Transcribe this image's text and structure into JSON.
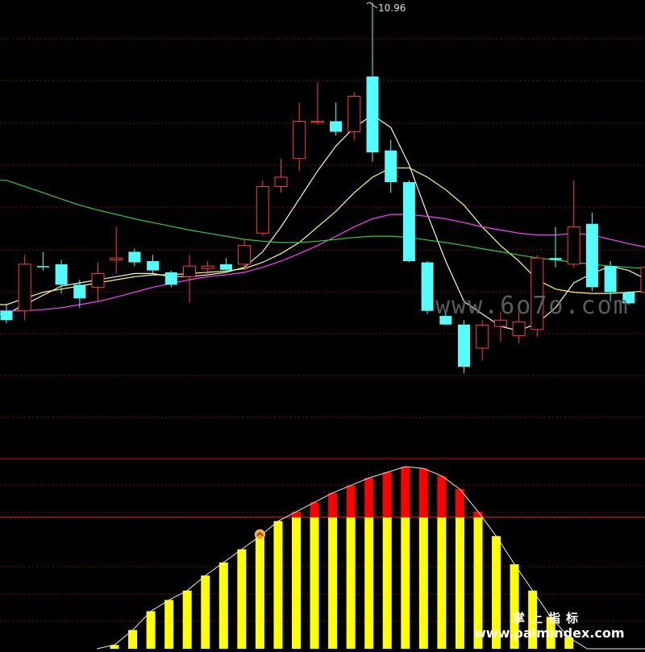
{
  "chart_data": {
    "type": "candlestick",
    "peak_label": "10.96",
    "price_ylim": [
      4.0,
      11.0
    ],
    "candles": [
      {
        "o": 6.0,
        "h": 6.1,
        "l": 5.8,
        "c": 5.85
      },
      {
        "o": 6.0,
        "h": 6.9,
        "l": 5.85,
        "c": 6.75
      },
      {
        "o": 6.72,
        "h": 6.95,
        "l": 6.65,
        "c": 6.7
      },
      {
        "o": 6.75,
        "h": 6.82,
        "l": 6.28,
        "c": 6.42
      },
      {
        "o": 6.42,
        "h": 6.5,
        "l": 6.05,
        "c": 6.2
      },
      {
        "o": 6.38,
        "h": 6.78,
        "l": 6.15,
        "c": 6.6
      },
      {
        "o": 6.82,
        "h": 7.35,
        "l": 6.6,
        "c": 6.85
      },
      {
        "o": 6.95,
        "h": 7.0,
        "l": 6.72,
        "c": 6.78
      },
      {
        "o": 6.8,
        "h": 6.9,
        "l": 6.58,
        "c": 6.65
      },
      {
        "o": 6.62,
        "h": 6.65,
        "l": 6.38,
        "c": 6.42
      },
      {
        "o": 6.55,
        "h": 6.9,
        "l": 6.13,
        "c": 6.72
      },
      {
        "o": 6.68,
        "h": 6.8,
        "l": 6.55,
        "c": 6.72
      },
      {
        "o": 6.75,
        "h": 6.85,
        "l": 6.65,
        "c": 6.66
      },
      {
        "o": 6.75,
        "h": 7.15,
        "l": 6.65,
        "c": 7.05
      },
      {
        "o": 7.25,
        "h": 8.1,
        "l": 7.2,
        "c": 8.0
      },
      {
        "o": 8.0,
        "h": 8.45,
        "l": 7.9,
        "c": 8.15
      },
      {
        "o": 8.45,
        "h": 9.35,
        "l": 8.25,
        "c": 9.05
      },
      {
        "o": 9.05,
        "h": 9.68,
        "l": 9.0,
        "c": 9.05
      },
      {
        "o": 9.05,
        "h": 9.35,
        "l": 8.82,
        "c": 8.88
      },
      {
        "o": 8.88,
        "h": 9.52,
        "l": 8.75,
        "c": 9.45
      },
      {
        "o": 9.77,
        "h": 10.96,
        "l": 8.4,
        "c": 8.55
      },
      {
        "o": 8.58,
        "h": 8.75,
        "l": 7.9,
        "c": 8.07
      },
      {
        "o": 8.07,
        "h": 8.1,
        "l": 6.78,
        "c": 6.8
      },
      {
        "o": 6.78,
        "h": 6.8,
        "l": 5.95,
        "c": 6.0
      },
      {
        "o": 5.92,
        "h": 5.97,
        "l": 5.77,
        "c": 5.78
      },
      {
        "o": 5.78,
        "h": 5.85,
        "l": 5.0,
        "c": 5.1
      },
      {
        "o": 5.4,
        "h": 5.85,
        "l": 5.2,
        "c": 5.77
      },
      {
        "o": 5.75,
        "h": 5.98,
        "l": 5.5,
        "c": 5.85
      },
      {
        "o": 5.6,
        "h": 5.98,
        "l": 5.48,
        "c": 5.82
      },
      {
        "o": 5.7,
        "h": 6.9,
        "l": 5.58,
        "c": 6.85
      },
      {
        "o": 6.85,
        "h": 7.35,
        "l": 6.7,
        "c": 6.82
      },
      {
        "o": 6.75,
        "h": 8.1,
        "l": 6.7,
        "c": 7.35
      },
      {
        "o": 7.4,
        "h": 7.58,
        "l": 6.32,
        "c": 6.38
      },
      {
        "o": 6.72,
        "h": 6.8,
        "l": 6.15,
        "c": 6.3
      },
      {
        "o": 6.3,
        "h": 6.32,
        "l": 6.1,
        "c": 6.12
      },
      {
        "o": 6.3,
        "h": 6.82,
        "l": 6.28,
        "c": 6.7
      }
    ],
    "ma_series": [
      {
        "color": "#f5f5dc",
        "values": [
          5.95,
          6.1,
          6.25,
          6.4,
          6.45,
          6.5,
          6.55,
          6.6,
          6.6,
          6.55,
          6.55,
          6.58,
          6.62,
          6.7,
          6.95,
          7.35,
          7.8,
          8.25,
          8.65,
          8.95,
          9.15,
          8.95,
          8.35,
          7.55,
          6.8,
          6.15,
          5.95,
          5.75,
          5.68,
          5.8,
          6.05,
          6.45,
          6.6,
          6.72,
          6.65,
          6.5
        ]
      },
      {
        "color": "#ffff66",
        "values": [
          6.1,
          6.2,
          6.3,
          6.35,
          6.4,
          6.45,
          6.5,
          6.55,
          6.58,
          6.58,
          6.6,
          6.62,
          6.64,
          6.68,
          6.78,
          6.92,
          7.1,
          7.35,
          7.6,
          7.9,
          8.15,
          8.3,
          8.3,
          8.15,
          7.95,
          7.7,
          7.35,
          7.05,
          6.8,
          6.5,
          6.35,
          6.3,
          6.28,
          6.28,
          6.3,
          6.32
        ]
      },
      {
        "color": "#ff3fff",
        "values": [
          6.0,
          6.0,
          6.02,
          6.05,
          6.1,
          6.15,
          6.22,
          6.3,
          6.38,
          6.44,
          6.5,
          6.55,
          6.58,
          6.62,
          6.7,
          6.8,
          6.92,
          7.05,
          7.2,
          7.35,
          7.48,
          7.55,
          7.55,
          7.52,
          7.48,
          7.42,
          7.35,
          7.3,
          7.25,
          7.22,
          7.22,
          7.25,
          7.22,
          7.15,
          7.08,
          7.02
        ]
      },
      {
        "color": "#2ecc40",
        "values": [
          8.1,
          8.0,
          7.9,
          7.8,
          7.7,
          7.62,
          7.55,
          7.48,
          7.42,
          7.36,
          7.3,
          7.25,
          7.2,
          7.15,
          7.12,
          7.1,
          7.1,
          7.12,
          7.15,
          7.18,
          7.2,
          7.2,
          7.18,
          7.14,
          7.1,
          7.05,
          7.0,
          6.95,
          6.9,
          6.85,
          6.82,
          6.78,
          6.75,
          6.72,
          6.7,
          6.68
        ]
      }
    ],
    "indicator": {
      "ylim": [
        0,
        100
      ],
      "levels": [
        70
      ],
      "values": [
        2,
        10,
        20,
        26,
        31,
        39,
        46,
        53,
        60,
        68,
        73,
        78,
        83,
        87,
        91,
        94,
        97,
        96,
        92,
        85,
        73,
        60,
        45,
        31,
        17,
        6,
        0
      ],
      "signal_index": 8,
      "colors": {
        "low": "#ffff00",
        "high": "#ff0000"
      }
    }
  },
  "watermarks": {
    "center": "www.6o7o.com",
    "brand_cn": "掌上指标",
    "brand_url": "www.palmindex.com"
  }
}
